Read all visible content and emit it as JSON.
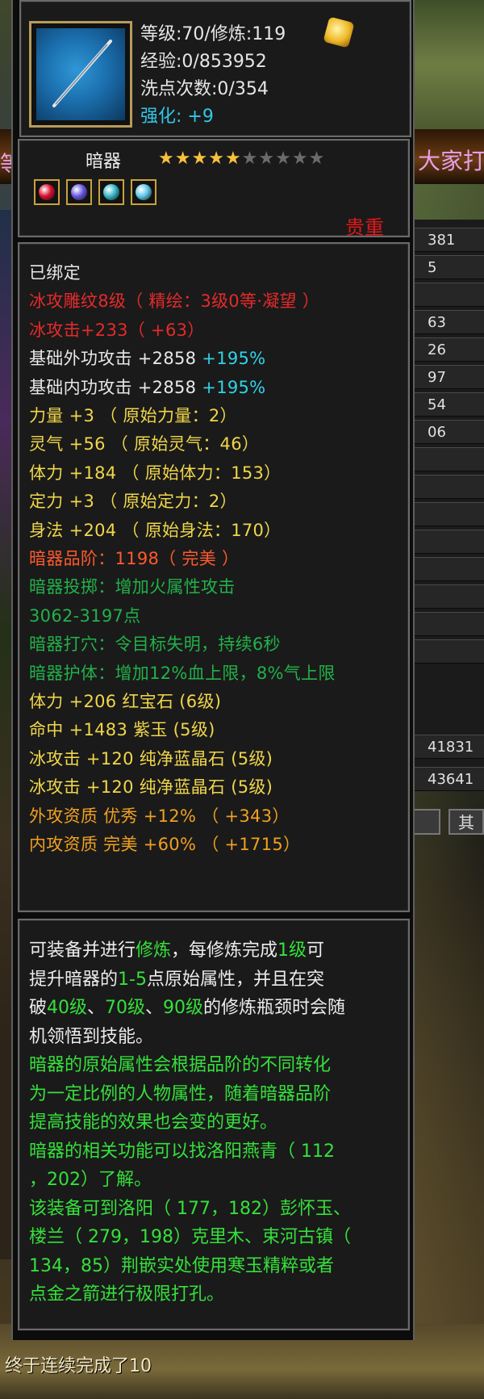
{
  "background": {
    "banner_text": "大家打",
    "left_banner_text": "等",
    "right_stats": [
      "381",
      "5",
      "",
      "63",
      "26",
      "97",
      "54",
      "06",
      "",
      "",
      "",
      "",
      "",
      "",
      "",
      "",
      "41831",
      "43641"
    ],
    "right_tab": "其"
  },
  "header": {
    "level_line": "等级:70/修炼:119",
    "exp_line": "经验:0/853952",
    "reset_line": "洗点次数:0/354",
    "enhance_label": "强化:",
    "enhance_value": "+9"
  },
  "item": {
    "type": "暗器",
    "stars_filled": 5,
    "stars_total": 10,
    "rarity": "贵重",
    "gem_colors": [
      "#d8102c",
      "#6a58e0",
      "#34b8c8",
      "#5ec8e8"
    ]
  },
  "attributes": [
    {
      "color": "white",
      "text": "已绑定"
    },
    {
      "color": "red",
      "text": "冰攻雕纹8级（ 精绘：3级0等·凝望 ）"
    },
    {
      "color": "red",
      "text": "冰攻击+233（ +63）"
    },
    {
      "color": "white",
      "text": "基础外功攻击 +2858 ",
      "extra": "+195%"
    },
    {
      "color": "white",
      "text": "基础内功攻击 +2858 ",
      "extra": "+195%"
    },
    {
      "color": "yellow",
      "text": "力量 +3 （ 原始力量：2）"
    },
    {
      "color": "yellow",
      "text": "灵气 +56 （ 原始灵气：46）"
    },
    {
      "color": "yellow",
      "text": "体力 +184 （ 原始体力：153）"
    },
    {
      "color": "yellow",
      "text": "定力 +3 （ 原始定力：2）"
    },
    {
      "color": "yellow",
      "text": "身法 +204 （ 原始身法：170）"
    },
    {
      "color": "orange",
      "text": "暗器品阶：1198（ 完美 ）"
    },
    {
      "color": "green",
      "text": "暗器投掷：增加火属性攻击"
    },
    {
      "color": "green",
      "text": "3062-3197点"
    },
    {
      "color": "green",
      "text": "暗器打穴：令目标失明，持续6秒"
    },
    {
      "color": "green",
      "text": "暗器护体：增加12%血上限，8%气上限"
    },
    {
      "color": "yellow",
      "text": "体力 +206 红宝石 (6级)"
    },
    {
      "color": "yellow",
      "text": "命中 +1483 紫玉 (5级)"
    },
    {
      "color": "yellow",
      "text": "冰攻击 +120 纯净蓝晶石 (5级)"
    },
    {
      "color": "yellow",
      "text": "冰攻击 +120 纯净蓝晶石 (5级)"
    },
    {
      "color": "gold",
      "text": "外攻资质 优秀 +12% （ +343）"
    },
    {
      "color": "gold",
      "text": "内攻资质 完美 +60% （ +1715）"
    }
  ],
  "description": [
    [
      {
        "c": "white",
        "t": "可装备并进行"
      },
      {
        "c": "green",
        "t": "修炼"
      },
      {
        "c": "white",
        "t": "，每修炼完成"
      },
      {
        "c": "green",
        "t": "1级"
      },
      {
        "c": "white",
        "t": "可"
      }
    ],
    [
      {
        "c": "white",
        "t": "提升暗器的"
      },
      {
        "c": "green",
        "t": "1-5"
      },
      {
        "c": "white",
        "t": "点原始属性，并且在突"
      }
    ],
    [
      {
        "c": "white",
        "t": "破"
      },
      {
        "c": "green",
        "t": "40级"
      },
      {
        "c": "white",
        "t": "、"
      },
      {
        "c": "green",
        "t": "70级"
      },
      {
        "c": "white",
        "t": "、"
      },
      {
        "c": "green",
        "t": "90级"
      },
      {
        "c": "white",
        "t": "的修炼瓶颈时会随"
      }
    ],
    [
      {
        "c": "white",
        "t": "机领悟到技能。"
      }
    ],
    [
      {
        "c": "green",
        "t": "暗器的原始属性会根据品阶的不同转化"
      }
    ],
    [
      {
        "c": "green",
        "t": "为一定比例的人物属性，随着暗器品阶"
      }
    ],
    [
      {
        "c": "green",
        "t": "提高技能的效果也会变的更好。"
      }
    ],
    [
      {
        "c": "green",
        "t": "暗器的相关功能可以找洛阳燕青（ 112"
      }
    ],
    [
      {
        "c": "green",
        "t": "，202）了解。"
      }
    ],
    [
      {
        "c": "green",
        "t": "该装备可到洛阳（ 177，182）彭怀玉、"
      }
    ],
    [
      {
        "c": "green",
        "t": "楼兰（ 279，198）克里木、束河古镇（"
      }
    ],
    [
      {
        "c": "green",
        "t": "134，85）荆嵌实处使用寒玉精粹或者"
      }
    ],
    [
      {
        "c": "green",
        "t": "点金之箭进行极限打孔。"
      }
    ]
  ],
  "chat": {
    "line": "终于连续完成了10"
  }
}
